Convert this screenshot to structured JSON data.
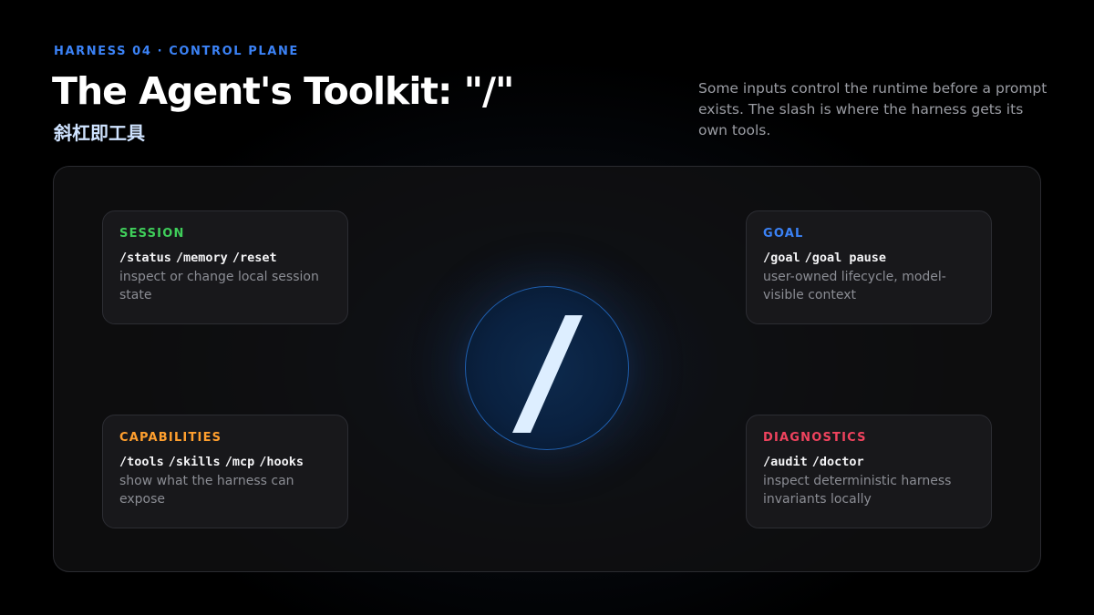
{
  "header": {
    "eyebrow": "HARNESS 04 · CONTROL PLANE",
    "title": "The Agent's Toolkit: \"/\"",
    "subtitle_cn": "斜杠即工具",
    "intro": "Some inputs control the runtime before a prompt exists. The slash is where the harness gets its own tools."
  },
  "center": {
    "symbol": "/"
  },
  "cards": {
    "session": {
      "label": "SESSION",
      "color": "#3fce5a",
      "commands": [
        "/status",
        "/memory",
        "/reset"
      ],
      "description": "inspect or change local session state"
    },
    "goal": {
      "label": "GOAL",
      "color": "#3b82f6",
      "commands": [
        "/goal",
        "/goal pause"
      ],
      "description": "user-owned lifecycle, model-visible context"
    },
    "capabilities": {
      "label": "CAPABILITIES",
      "color": "#ff9f2e",
      "commands": [
        "/tools",
        "/skills",
        "/mcp",
        "/hooks"
      ],
      "description": "show what the harness can expose"
    },
    "diagnostics": {
      "label": "DIAGNOSTICS",
      "color": "#f0435e",
      "commands": [
        "/audit",
        "/doctor"
      ],
      "description": "inspect deterministic harness invariants locally"
    }
  }
}
